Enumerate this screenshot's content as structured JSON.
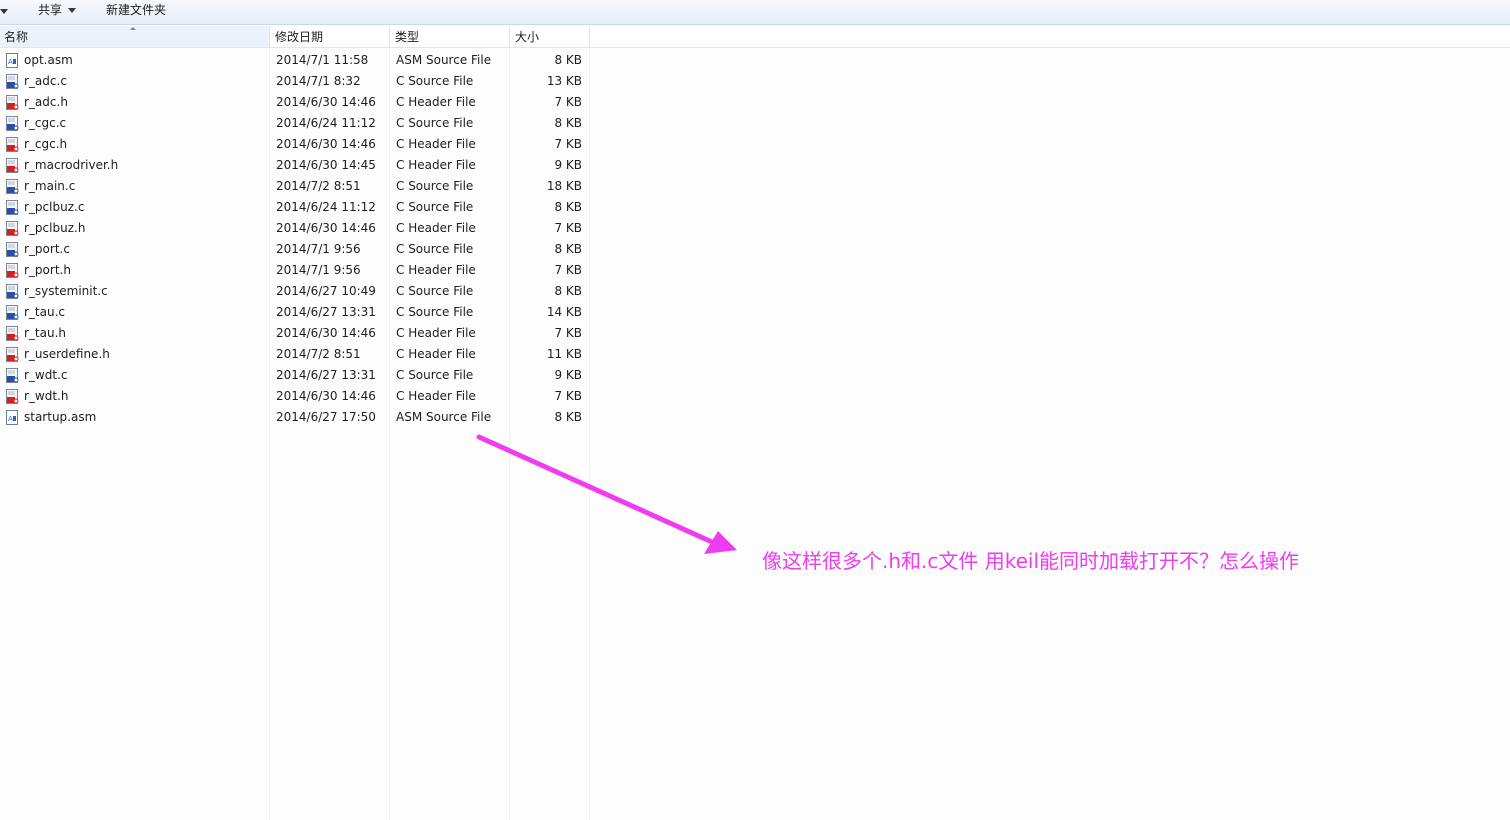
{
  "toolbar": {
    "share_label": "共享",
    "new_folder_label": "新建文件夹"
  },
  "columns": {
    "name": "名称",
    "date": "修改日期",
    "type": "类型",
    "size": "大小"
  },
  "files": [
    {
      "name": "opt.asm",
      "date": "2014/7/1 11:58",
      "type": "ASM Source File",
      "size": "8 KB",
      "icon": "asm-file-icon"
    },
    {
      "name": "r_adc.c",
      "date": "2014/7/1 8:32",
      "type": "C Source File",
      "size": "13 KB",
      "icon": "c-source-file-icon"
    },
    {
      "name": "r_adc.h",
      "date": "2014/6/30 14:46",
      "type": "C Header File",
      "size": "7 KB",
      "icon": "c-header-file-icon"
    },
    {
      "name": "r_cgc.c",
      "date": "2014/6/24 11:12",
      "type": "C Source File",
      "size": "8 KB",
      "icon": "c-source-file-icon"
    },
    {
      "name": "r_cgc.h",
      "date": "2014/6/30 14:46",
      "type": "C Header File",
      "size": "7 KB",
      "icon": "c-header-file-icon"
    },
    {
      "name": "r_macrodriver.h",
      "date": "2014/6/30 14:45",
      "type": "C Header File",
      "size": "9 KB",
      "icon": "c-header-file-icon"
    },
    {
      "name": "r_main.c",
      "date": "2014/7/2 8:51",
      "type": "C Source File",
      "size": "18 KB",
      "icon": "c-source-file-icon"
    },
    {
      "name": "r_pclbuz.c",
      "date": "2014/6/24 11:12",
      "type": "C Source File",
      "size": "8 KB",
      "icon": "c-source-file-icon"
    },
    {
      "name": "r_pclbuz.h",
      "date": "2014/6/30 14:46",
      "type": "C Header File",
      "size": "7 KB",
      "icon": "c-header-file-icon"
    },
    {
      "name": "r_port.c",
      "date": "2014/7/1 9:56",
      "type": "C Source File",
      "size": "8 KB",
      "icon": "c-source-file-icon"
    },
    {
      "name": "r_port.h",
      "date": "2014/7/1 9:56",
      "type": "C Header File",
      "size": "7 KB",
      "icon": "c-header-file-icon"
    },
    {
      "name": "r_systeminit.c",
      "date": "2014/6/27 10:49",
      "type": "C Source File",
      "size": "8 KB",
      "icon": "c-source-file-icon"
    },
    {
      "name": "r_tau.c",
      "date": "2014/6/27 13:31",
      "type": "C Source File",
      "size": "14 KB",
      "icon": "c-source-file-icon"
    },
    {
      "name": "r_tau.h",
      "date": "2014/6/30 14:46",
      "type": "C Header File",
      "size": "7 KB",
      "icon": "c-header-file-icon"
    },
    {
      "name": "r_userdefine.h",
      "date": "2014/7/2 8:51",
      "type": "C Header File",
      "size": "11 KB",
      "icon": "c-header-file-icon"
    },
    {
      "name": "r_wdt.c",
      "date": "2014/6/27 13:31",
      "type": "C Source File",
      "size": "9 KB",
      "icon": "c-source-file-icon"
    },
    {
      "name": "r_wdt.h",
      "date": "2014/6/30 14:46",
      "type": "C Header File",
      "size": "7 KB",
      "icon": "c-header-file-icon"
    },
    {
      "name": "startup.asm",
      "date": "2014/6/27 17:50",
      "type": "ASM Source File",
      "size": "8 KB",
      "icon": "asm-file-icon"
    }
  ],
  "annotation": {
    "text": "像这样很多个.h和.c文件  用keil能同时加载打开不？怎么操作",
    "color": "#f03cf0"
  }
}
